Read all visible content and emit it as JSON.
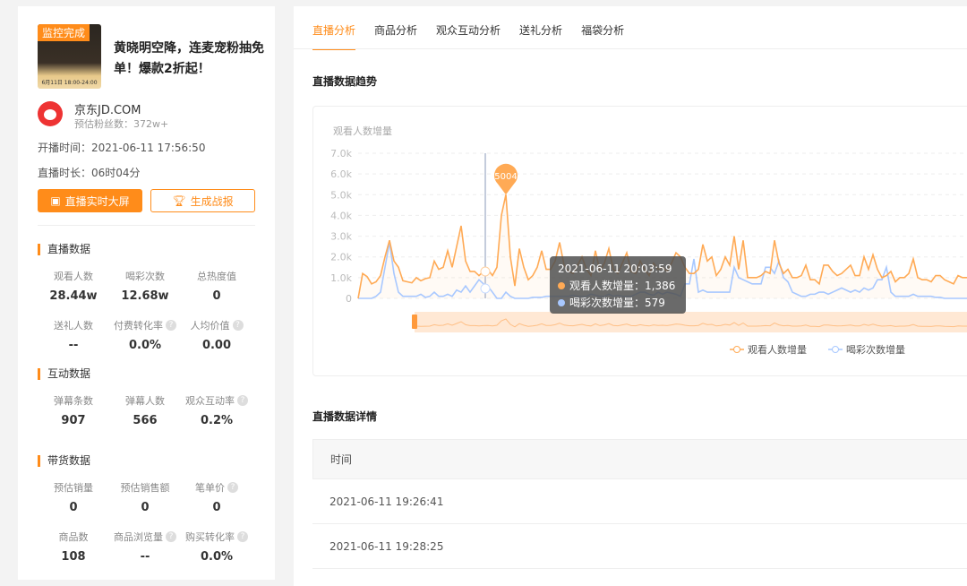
{
  "left": {
    "badge": "监控完成",
    "cover_date": "6月11日 18:00-24:00",
    "title": "黄晓明空降，连麦宠粉抽免单！爆款2折起！",
    "shop": "京东JD.COM",
    "fans": "预估粉丝数：372w+",
    "start_time": "开播时间：2021-06-11 17:56:50",
    "duration": "直播时长：06时04分",
    "btn_screen": "直播实时大屏",
    "btn_report": "生成战报",
    "sections": [
      {
        "title": "直播数据",
        "stats": [
          {
            "l": "观看人数",
            "v": "28.44w"
          },
          {
            "l": "喝彩次数",
            "v": "12.68w"
          },
          {
            "l": "总热度值",
            "v": "0"
          },
          {
            "l": "送礼人数",
            "v": "--"
          },
          {
            "l": "付费转化率",
            "v": "0.0%",
            "q": true
          },
          {
            "l": "人均价值",
            "v": "0.00",
            "q": true
          }
        ]
      },
      {
        "title": "互动数据",
        "stats": [
          {
            "l": "弹幕条数",
            "v": "907"
          },
          {
            "l": "弹幕人数",
            "v": "566"
          },
          {
            "l": "观众互动率",
            "v": "0.2%",
            "q": true
          }
        ]
      },
      {
        "title": "带货数据",
        "stats": [
          {
            "l": "预估销量",
            "v": "0"
          },
          {
            "l": "预估销售额",
            "v": "0"
          },
          {
            "l": "笔单价",
            "v": "0",
            "q": true
          },
          {
            "l": "商品数",
            "v": "108"
          },
          {
            "l": "商品浏览量",
            "v": "--",
            "q": true
          },
          {
            "l": "购买转化率",
            "v": "0.0%",
            "q": true
          }
        ]
      }
    ]
  },
  "main": {
    "tabs": [
      "直播分析",
      "商品分析",
      "观众互动分析",
      "送礼分析",
      "福袋分析"
    ],
    "trend_title": "直播数据趋势",
    "detail_title": "直播数据详情",
    "table": {
      "header": "时间",
      "rows": [
        "2021-06-11 19:26:41",
        "2021-06-11 19:28:25"
      ]
    }
  },
  "chart_data": {
    "type": "line",
    "ylabel": "观看人数增量",
    "ylim": [
      0,
      7000
    ],
    "yticks": [
      "0",
      "1.0k",
      "2.0k",
      "3.0k",
      "4.0k",
      "5.0k",
      "6.0k",
      "7.0k"
    ],
    "colors": {
      "viewers": "#ffaa55",
      "cheers": "#a8c8ff"
    },
    "series": [
      {
        "name": "观看人数增量",
        "values": [
          0,
          1200,
          1050,
          700,
          800,
          1100,
          2000,
          2800,
          1800,
          1500,
          850,
          800,
          750,
          1000,
          850,
          950,
          1000,
          1800,
          1400,
          1500,
          2300,
          1500,
          2500,
          3500,
          1800,
          1300,
          1300,
          1100,
          1300,
          1386,
          1100,
          1500,
          4000,
          5004,
          2000,
          600,
          2400,
          1500,
          900,
          1100,
          1500,
          2300,
          1400,
          1400,
          1800,
          2700,
          1600,
          1300,
          1200,
          1600,
          2000,
          1400,
          1100,
          2300,
          1300,
          1700,
          2400,
          1400,
          1200,
          1700,
          2200,
          1300,
          1200,
          1800,
          1400,
          1100,
          1700,
          1400,
          1500,
          1300,
          1700,
          2200,
          2000,
          1500,
          1200,
          1200,
          1400,
          2600,
          1800,
          2000,
          1100,
          1400,
          2000,
          1600,
          3000,
          1400,
          2800,
          1000,
          1000,
          1000,
          1100,
          1300,
          1200,
          2800,
          1700,
          1200,
          1400,
          1000,
          1000,
          1100,
          1600,
          900,
          900,
          700,
          1600,
          1600,
          1300,
          1100,
          1200,
          1400,
          1600,
          1100,
          1100,
          2000,
          1400,
          2100,
          1400,
          1000,
          1100,
          1300,
          800,
          1000,
          1000,
          1200,
          1900,
          1000,
          900,
          900,
          800,
          1100,
          1100,
          900,
          800,
          700,
          1100,
          1000,
          1000
        ]
      },
      {
        "name": "喝彩次数增量",
        "values": [
          0,
          0,
          0,
          0,
          100,
          300,
          1500,
          2700,
          1200,
          300,
          100,
          100,
          100,
          100,
          200,
          50,
          100,
          300,
          100,
          100,
          200,
          100,
          400,
          300,
          600,
          300,
          600,
          900,
          700,
          579,
          300,
          0,
          0,
          300,
          100,
          0,
          0,
          0,
          0,
          50,
          50,
          50,
          100,
          100,
          100,
          100,
          100,
          100,
          150,
          100,
          100,
          100,
          200,
          150,
          100,
          100,
          200,
          100,
          150,
          100,
          100,
          100,
          200,
          300,
          300,
          200,
          150,
          300,
          200,
          300,
          250,
          200,
          100,
          700,
          700,
          1900,
          300,
          400,
          300,
          300,
          300,
          300,
          300,
          300,
          1500,
          1000,
          900,
          800,
          700,
          700,
          700,
          1500,
          1500,
          1200,
          1800,
          1000,
          800,
          300,
          200,
          100,
          100,
          200,
          200,
          300,
          300,
          200,
          300,
          400,
          500,
          400,
          300,
          400,
          300,
          500,
          400,
          500,
          900,
          900,
          1500,
          300,
          100,
          100,
          100,
          100,
          200,
          100,
          100,
          100,
          100,
          50,
          50,
          0,
          0,
          0,
          0,
          0,
          0,
          0
        ]
      }
    ],
    "marker": {
      "label": "5004"
    },
    "tooltip": {
      "time": "2021-06-11 20:03:59",
      "lines": [
        "观看人数增量：1,386",
        "喝彩次数增量：579"
      ]
    }
  }
}
